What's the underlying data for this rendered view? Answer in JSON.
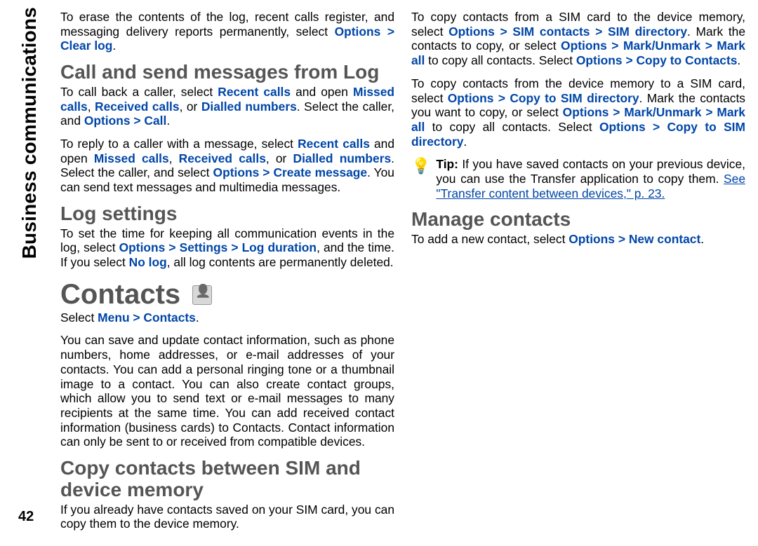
{
  "page": {
    "vtab": "Business communications",
    "number": "42"
  },
  "blocks": {
    "erase_p": {
      "t1": "To erase the contents of the log, recent calls register, and messaging delivery reports permanently, select ",
      "opt": "Options",
      "gt1": " > ",
      "clr": "Clear log",
      "end": "."
    },
    "h_call": "Call and send messages from Log",
    "callback_p": {
      "t1": "To call back a caller, select ",
      "u1": "Recent calls",
      "t2": " and open ",
      "u2": "Missed calls",
      "c1": ", ",
      "u3": "Received calls",
      "c2": ", or ",
      "u4": "Dialled numbers",
      "t3": ". Select the caller, and ",
      "u5": "Options",
      "gt": " > ",
      "u6": "Call",
      "end": "."
    },
    "reply_p": {
      "t1": "To reply to a caller with a message, select ",
      "u1": "Recent calls",
      "t2": " and open ",
      "u2": "Missed calls",
      "c1": ", ",
      "u3": "Received calls",
      "c2": ", or ",
      "u4": "Dialled numbers",
      "t3": ". Select the caller, and select ",
      "u5": "Options",
      "gt": " > ",
      "u6": "Create message",
      "t4": ". You can send text messages and multimedia messages."
    },
    "h_logset": "Log settings",
    "logset_p": {
      "t1": "To set the time for keeping all communication events in the log, select ",
      "u1": "Options",
      "gt1": " > ",
      "u2": "Settings",
      "gt2": " > ",
      "u3": "Log duration",
      "t2": ", and the time. If you select ",
      "u4": "No log",
      "t3": ", all log contents are permanently deleted."
    },
    "h_contacts": "Contacts",
    "contacts_intro": {
      "t1": "Select ",
      "u1": "Menu",
      "gt": " > ",
      "u2": "Contacts",
      "end": "."
    },
    "contacts_p": "You can save and update contact information, such as phone numbers, home addresses, or e-mail addresses of your contacts. You can add a personal ringing tone or a thumbnail image to a contact. You can also create contact groups, which allow you to send text or e-mail messages to many recipients at the same time. You can add received contact information (business cards) to Contacts. Contact information can only be sent to or received from compatible devices.",
    "h_copy": "Copy contacts between SIM and device memory",
    "copy_intro": "If you already have contacts saved on your SIM card, you can copy them to the device memory.",
    "copy_p1": {
      "t1": "To copy contacts from a SIM card to the device memory, select ",
      "u1": "Options",
      "gt1": " > ",
      "u2": "SIM contacts",
      "gt2": " > ",
      "u3": "SIM directory",
      "t2": ". Mark the contacts to copy, or select ",
      "u4": "Options",
      "gt3": " > ",
      "u5": "Mark/Unmark",
      "gt4": " > ",
      "u6": "Mark all",
      "t3": " to copy all contacts. Select ",
      "u7": "Options",
      "gt5": " > ",
      "u8": "Copy to Contacts",
      "end": "."
    },
    "copy_p2": {
      "t1": "To copy contacts from the device memory to a SIM card, select ",
      "u1": "Options",
      "gt1": " > ",
      "u2": "Copy to SIM directory",
      "t2": ". Mark the contacts you want to copy, or select ",
      "u3": "Options",
      "gt2": " > ",
      "u4": "Mark/Unmark",
      "gt3": " > ",
      "u5": "Mark all",
      "t3": " to copy all contacts. Select ",
      "u6": "Options",
      "gt4": " > ",
      "u7": "Copy to SIM directory",
      "end": "."
    },
    "tip": {
      "label": "Tip: ",
      "t1": "If you have saved contacts on your previous device, you can use the Transfer application to copy them. ",
      "link": "See \"Transfer content between devices,\" p. 23."
    },
    "h_manage": "Manage contacts",
    "manage_p": {
      "t1": "To add a new contact, select ",
      "u1": "Options",
      "gt": " > ",
      "u2": "New contact",
      "end": "."
    }
  }
}
